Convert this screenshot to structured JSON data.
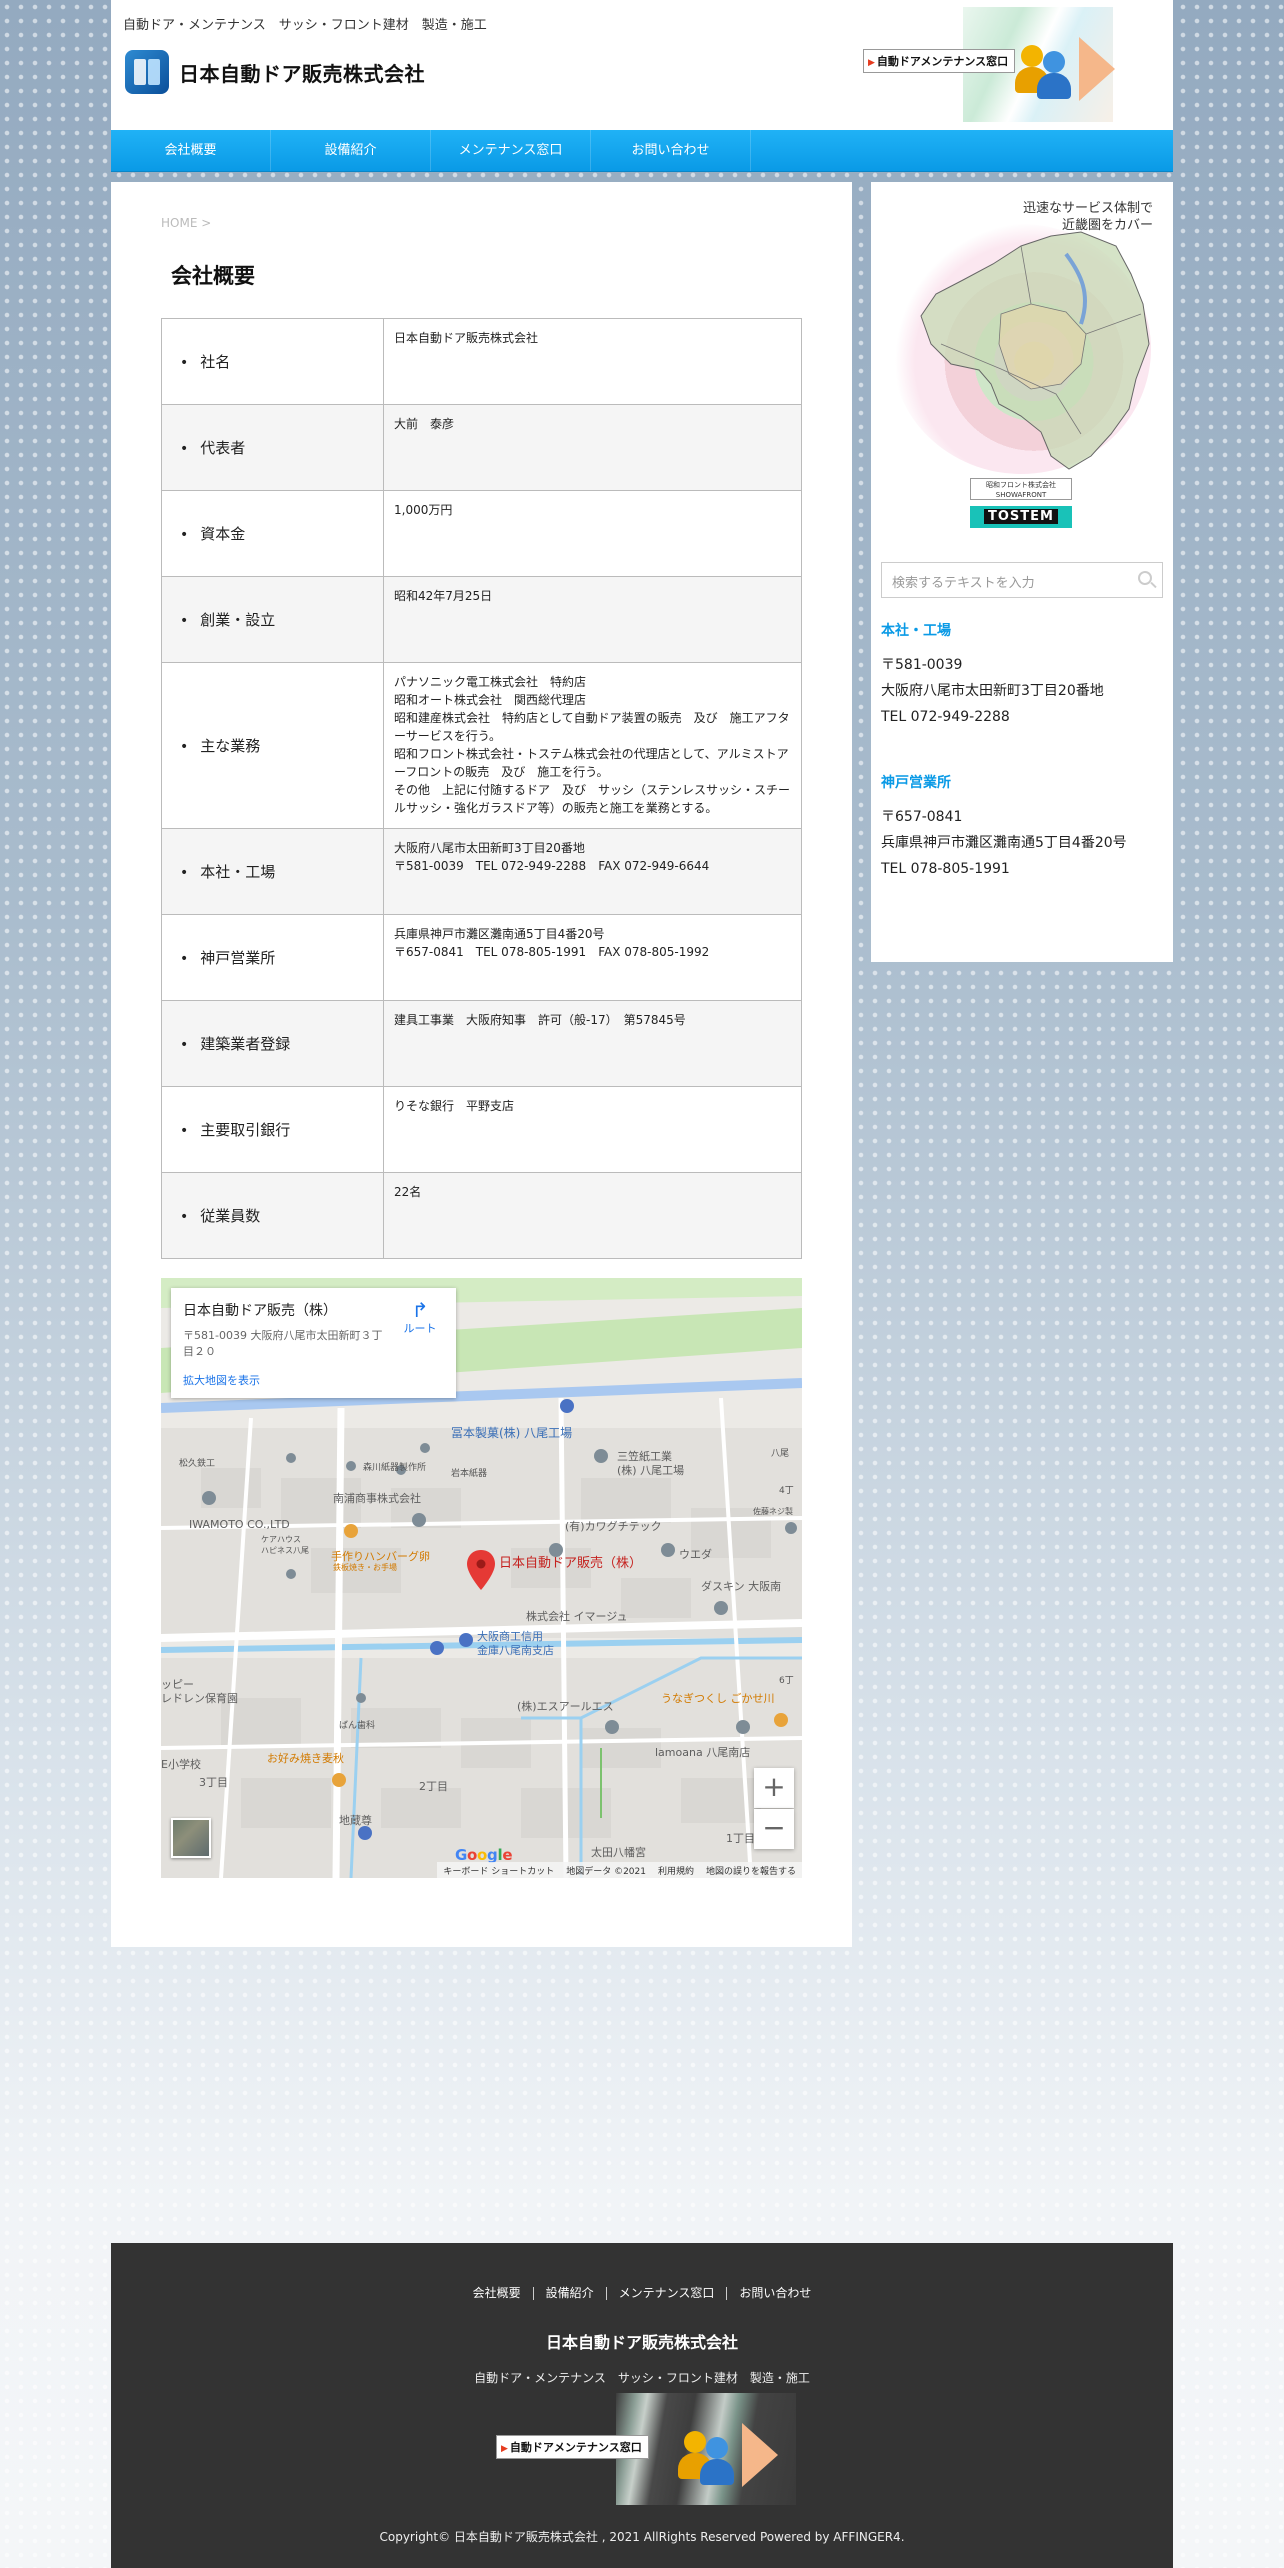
{
  "header": {
    "tagline": "自動ドア・メンテナンス　サッシ・フロント建材　製造・施工",
    "logo_text": "日本自動ドア販売株式会社",
    "banner_label": "自動ドアメンテナンス窓口"
  },
  "nav": {
    "items": [
      {
        "label": "会社概要"
      },
      {
        "label": "設備紹介"
      },
      {
        "label": "メンテナンス窓口"
      },
      {
        "label": "お問い合わせ"
      }
    ]
  },
  "main": {
    "breadcrumb": "HOME >",
    "title": "会社概要",
    "rows": [
      {
        "label": "社名",
        "value": "日本自動ドア販売株式会社"
      },
      {
        "label": "代表者",
        "value": "大前　泰彦"
      },
      {
        "label": "資本金",
        "value": "1,000万円"
      },
      {
        "label": "創業・設立",
        "value": "昭和42年7月25日"
      },
      {
        "label": "主な業務",
        "value": "パナソニック電工株式会社　特約店\n昭和オート株式会社　関西総代理店\n昭和建産株式会社　特約店として自動ドア装置の販売　及び　施工アフターサービスを行う。\n昭和フロント株式会社・トステム株式会社の代理店として、アルミストアーフロントの販売　及び　施工を行う。\nその他　上記に付随するドア　及び　サッシ（ステンレスサッシ・スチールサッシ・強化ガラスドア等）の販売と施工を業務とする。"
      },
      {
        "label": "本社・工場",
        "value": "大阪府八尾市太田新町3丁目20番地\n〒581-0039　TEL 072-949-2288　FAX 072-949-6644"
      },
      {
        "label": "神戸営業所",
        "value": "兵庫県神戸市灘区灘南通5丁目4番20号\n〒657-0841　TEL 078-805-1991　FAX 078-805-1992"
      },
      {
        "label": "建築業者登録",
        "value": "建具工事業　大阪府知事　許可（般-17）　第57845号"
      },
      {
        "label": "主要取引銀行",
        "value": "りそな銀行　平野支店"
      },
      {
        "label": "従業員数",
        "value": "22名"
      }
    ]
  },
  "map": {
    "card_name": "日本自動ドア販売（株）",
    "card_address": "〒581-0039 大阪府八尾市太田新町３丁目２０",
    "card_link": "拡大地図を表示",
    "route_label": "ルート",
    "zoom_in": "+",
    "zoom_out": "−",
    "brand": "Google",
    "footer": {
      "shortcuts": "キーボード ショートカット",
      "data": "地図データ ©2021",
      "terms": "利用規約",
      "report": "地図の誤りを報告する"
    },
    "labels": {
      "pin": "日本自動ドア販売（株）",
      "fuji": "冨本製菓(株) 八尾工場",
      "mikasa": "三笠紙工業\n(株) 八尾工場",
      "minamiura": "南浦商事株式会社",
      "iwamoto": "IWAMOTO CO.,LTD",
      "kawaguchi": "(有)カワグチテック",
      "hamburg": "手作りハンバーグ卵",
      "hamburg_sub": "鉄板焼き・お手場",
      "ueda": "ウエダ",
      "daikin": "ダスキン 大阪南",
      "image": "株式会社 イマージュ",
      "shinkin": "大阪商工信用\n金庫八尾南支店",
      "es": "(株)エスアールエス",
      "unagi": "うなぎつくし ごかせ川",
      "lamoana": "lamoana 八尾南店",
      "okonomi": "お好み焼き麦秋",
      "nursery": "ッピー\nレドレン保育園",
      "school": "E小学校",
      "chome3": "3丁目",
      "chome2": "2丁目",
      "chome1": "1丁目",
      "jizo": "地蔵尊",
      "ota": "太田八幡宮",
      "matsuhisa": "松久鉄工",
      "morikawa": "森川紙器製作所",
      "iwamoto_home": "岩本紙器",
      "yatsushiro": "八尾",
      "kepahouse": "ケアハウス\nハピネス八尾",
      "ban": "ばん歯科",
      "chome4": "4丁",
      "sato": "佐藤ネジ製",
      "chome6": "6丁"
    }
  },
  "sidebar": {
    "map_caption": "迅速なサービス体制で\n近畿圏をカバー",
    "showa": "昭和フロント株式会社\nSHOWAFRONT",
    "tostem": "TOSTEM",
    "search_placeholder": "検索するテキストを入力",
    "honsha_title": "本社・工場",
    "honsha_zip": "〒581-0039",
    "honsha_addr": "大阪府八尾市太田新町3丁目20番地",
    "honsha_tel": "TEL 072-949-2288",
    "kobe_title": "神戸営業所",
    "kobe_zip": "〒657-0841",
    "kobe_addr": "兵庫県神戸市灘区灘南通5丁目4番20号",
    "kobe_tel": "TEL 078-805-1991"
  },
  "footer": {
    "nav": [
      "会社概要",
      "設備紹介",
      "メンテナンス窓口",
      "お問い合わせ"
    ],
    "name": "日本自動ドア販売株式会社",
    "tagline": "自動ドア・メンテナンス　サッシ・フロント建材　製造・施工",
    "banner_label": "自動ドアメンテナンス窓口",
    "copyright": "Copyright© 日本自動ドア販売株式会社 , 2021 AllRights Reserved Powered by AFFINGER4."
  },
  "colors": {
    "accent": "#0a9ae6",
    "footer_bg": "#333333",
    "pin": "#e53935"
  }
}
